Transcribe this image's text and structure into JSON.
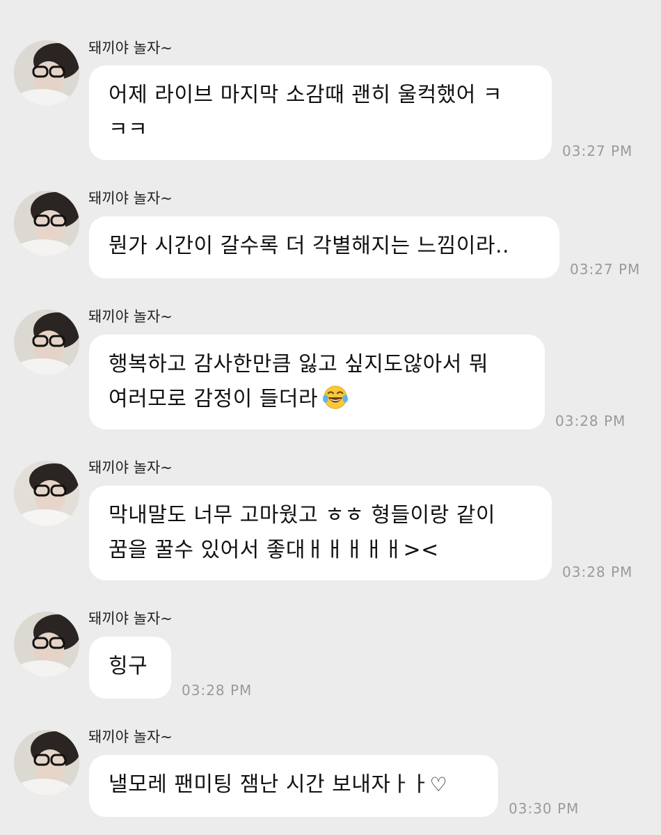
{
  "chat": {
    "messages": [
      {
        "sender": "돼끼야 놀자~",
        "lines": [
          "어제 라이브 마지막 소감때 괜히 울컥했어 ㅋ",
          "ㅋㅋ"
        ],
        "time": "03:27 PM"
      },
      {
        "sender": "돼끼야 놀자~",
        "lines": [
          "뭔가 시간이 갈수록 더 각별해지는 느낌이라.."
        ],
        "time": "03:27 PM"
      },
      {
        "sender": "돼끼야 놀자~",
        "lines": [
          "행복하고 감사한만큼 잃고 싶지도않아서 뭐",
          "여러모로 감정이 들더라"
        ],
        "emoji": "tears-of-joy-emoji",
        "time": "03:28 PM"
      },
      {
        "sender": "돼끼야 놀자~",
        "lines": [
          "막내말도 너무 고마웠고 ㅎㅎ 형들이랑 같이",
          "꿈을 꿀수 있어서 좋대ㅐㅐㅐㅐㅐ><"
        ],
        "time": "03:28 PM"
      },
      {
        "sender": "돼끼야 놀자~",
        "lines": [
          "힝구"
        ],
        "time": "03:28 PM"
      },
      {
        "sender": "돼끼야 놀자~",
        "lines": [
          "낼모레 팬미팅 잼난 시간 보내자ㅏㅏ"
        ],
        "heart": "♡",
        "time": "03:30 PM"
      }
    ]
  },
  "colors": {
    "background": "#ececec",
    "bubble": "#ffffff",
    "text": "#111111",
    "timestamp": "#9a9a9a"
  }
}
